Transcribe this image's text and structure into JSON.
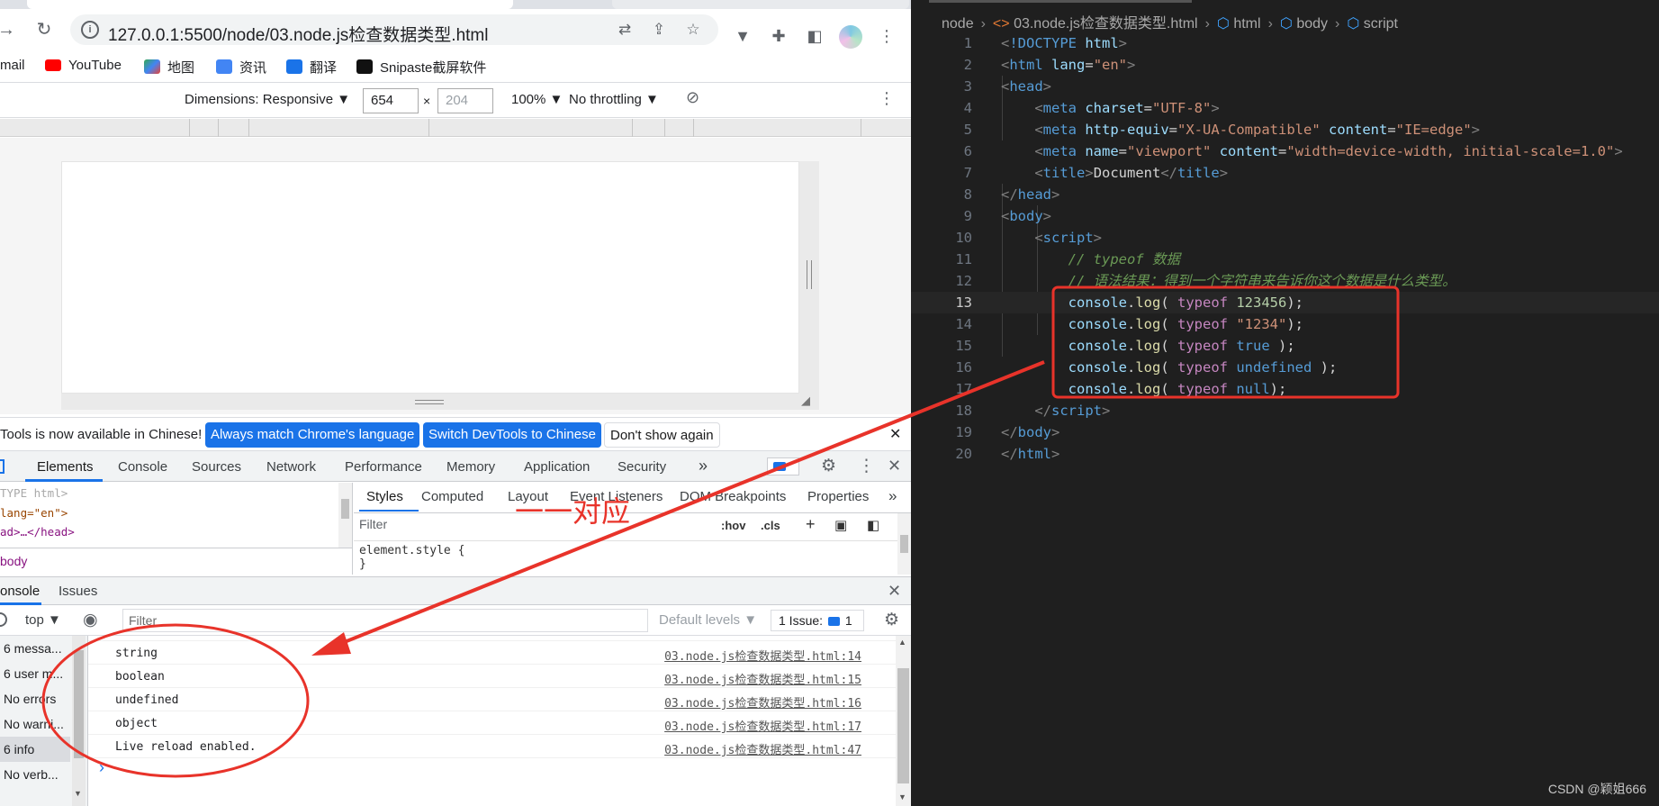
{
  "browser": {
    "url": "127.0.0.1:5500/node/03.node.js检查数据类型.html",
    "bookmarks": [
      "mail",
      "YouTube",
      "地图",
      "资讯",
      "翻译",
      "Snipaste截屏软件"
    ]
  },
  "device_toolbar": {
    "dimensions_label": "Dimensions: Responsive ▼",
    "width_value": "654",
    "height_placeholder": "204",
    "zoom": "100% ▼",
    "throttling": "No throttling ▼"
  },
  "infobar": {
    "message": "Tools is now available in Chinese!",
    "btn_match": "Always match Chrome's language",
    "btn_switch": "Switch DevTools to Chinese",
    "btn_dont": "Don't show again"
  },
  "devtools": {
    "tabs": [
      "Elements",
      "Console",
      "Sources",
      "Network",
      "Performance",
      "Memory",
      "Application",
      "Security"
    ],
    "more": "»",
    "elements_lines": [
      "TYPE html>",
      " lang=\"en\">",
      "ad>…</head>"
    ],
    "crumb": "body",
    "styles_tabs": [
      "Styles",
      "Computed",
      "Layout",
      "Event Listeners",
      "DOM Breakpoints",
      "Properties"
    ],
    "styles_filter": "Filter",
    "hov": ":hov",
    "cls": ".cls",
    "element_style": "element.style {",
    "close_brace": "}"
  },
  "drawer": {
    "tabs": [
      "onsole",
      "Issues"
    ],
    "context": "top ▼",
    "filter_placeholder": "Filter",
    "levels": "Default levels ▼",
    "issues": "1 Issue:",
    "issues_count": "1"
  },
  "console_sidebar": [
    "6 messa...",
    "6 user m...",
    "No errors",
    "No warni...",
    "6 info",
    "No verb..."
  ],
  "console_messages": [
    {
      "text": "string",
      "source": "03.node.js检查数据类型.html:14"
    },
    {
      "text": "boolean",
      "source": "03.node.js检查数据类型.html:15"
    },
    {
      "text": "undefined",
      "source": "03.node.js检查数据类型.html:16"
    },
    {
      "text": "object",
      "source": "03.node.js检查数据类型.html:17"
    },
    {
      "text": "Live reload enabled.",
      "source": "03.node.js检查数据类型.html:47"
    }
  ],
  "prompt_glyph": "›",
  "editor": {
    "breadcrumb": [
      "node",
      "03.node.js检查数据类型.html",
      "html",
      "body",
      "script"
    ],
    "line_numbers": [
      "1",
      "2",
      "3",
      "4",
      "5",
      "6",
      "7",
      "8",
      "9",
      "10",
      "11",
      "12",
      "13",
      "14",
      "15",
      "16",
      "17",
      "18",
      "19",
      "20"
    ],
    "current_line": "13",
    "watermark": "CSDN @颖姐666"
  },
  "annotation": {
    "label": "一一对应",
    "color": "#e8332a"
  }
}
